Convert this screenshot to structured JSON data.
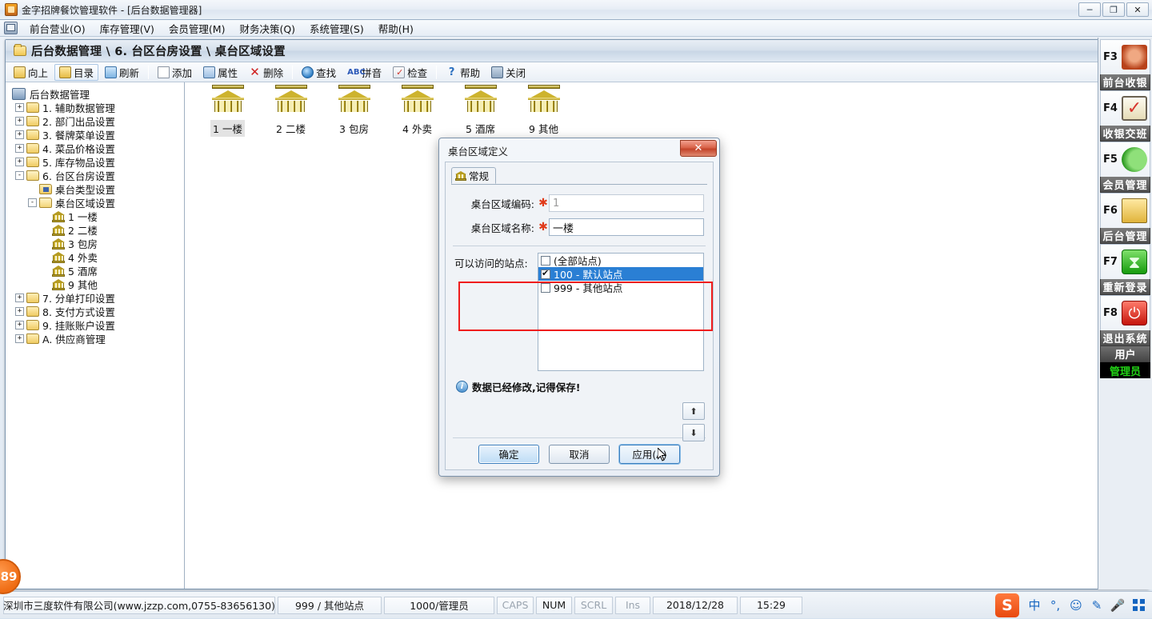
{
  "window": {
    "title": "金字招牌餐饮管理软件 - [后台数据管理器]",
    "app_icon": "app-logo-icon",
    "controls": {
      "minimize": "─",
      "restore": "❐",
      "close": "✕"
    }
  },
  "menubar": {
    "icon": "mdi-system-icon",
    "items": [
      {
        "label": "前台营业(O)"
      },
      {
        "label": "库存管理(V)"
      },
      {
        "label": "会员管理(M)"
      },
      {
        "label": "财务决策(Q)"
      },
      {
        "label": "系统管理(S)"
      },
      {
        "label": "帮助(H)"
      }
    ]
  },
  "mdi": {
    "controls": {
      "minimize": "─",
      "restore": "❐",
      "close": "✕"
    },
    "breadcrumb": {
      "icon": "folder-icon",
      "text": "后台数据管理 \\ 6. 台区台房设置 \\ 桌台区域设置"
    },
    "toolbar": [
      {
        "label": "向上",
        "icon": "up-folder-icon",
        "hot": false
      },
      {
        "label": "目录",
        "icon": "directory-icon",
        "hot": true
      },
      {
        "label": "刷新",
        "icon": "refresh-icon",
        "hot": false
      },
      {
        "sep": true
      },
      {
        "label": "添加",
        "icon": "add-icon",
        "hot": false
      },
      {
        "label": "属性",
        "icon": "properties-icon",
        "hot": false
      },
      {
        "label": "删除",
        "icon": "delete-icon",
        "hot": false
      },
      {
        "sep": true
      },
      {
        "label": "查找",
        "icon": "search-icon",
        "hot": false
      },
      {
        "label": "拼音",
        "icon": "pinyin-icon",
        "hot": false
      },
      {
        "label": "检查",
        "icon": "check-icon",
        "hot": false
      },
      {
        "sep": true
      },
      {
        "label": "帮助",
        "icon": "help-icon",
        "hot": false
      },
      {
        "label": "关闭",
        "icon": "close-door-icon",
        "hot": false
      }
    ]
  },
  "tree": {
    "root": {
      "label": "后台数据管理",
      "icon": "database-root-icon"
    },
    "nodes": [
      {
        "label": "1. 辅助数据管理",
        "expander": "+",
        "icon": "folder-icon",
        "indent": 1
      },
      {
        "label": "2. 部门出品设置",
        "expander": "+",
        "icon": "folder-icon",
        "indent": 1
      },
      {
        "label": "3. 餐牌菜单设置",
        "expander": "+",
        "icon": "folder-icon",
        "indent": 1
      },
      {
        "label": "4. 菜品价格设置",
        "expander": "+",
        "icon": "folder-icon",
        "indent": 1
      },
      {
        "label": "5. 库存物品设置",
        "expander": "+",
        "icon": "folder-icon",
        "indent": 1
      },
      {
        "label": "6. 台区台房设置",
        "expander": "-",
        "icon": "folder-open-icon",
        "indent": 1
      },
      {
        "label": "桌台类型设置",
        "expander": "",
        "icon": "folder-star-icon",
        "indent": 2
      },
      {
        "label": "桌台区域设置",
        "expander": "-",
        "icon": "folder-open-icon",
        "indent": 2
      },
      {
        "label": "1 一楼",
        "expander": "",
        "icon": "bank-icon",
        "indent": 3
      },
      {
        "label": "2 二楼",
        "expander": "",
        "icon": "bank-icon",
        "indent": 3
      },
      {
        "label": "3 包房",
        "expander": "",
        "icon": "bank-icon",
        "indent": 3
      },
      {
        "label": "4 外卖",
        "expander": "",
        "icon": "bank-icon",
        "indent": 3
      },
      {
        "label": "5 酒席",
        "expander": "",
        "icon": "bank-icon",
        "indent": 3
      },
      {
        "label": "9 其他",
        "expander": "",
        "icon": "bank-icon",
        "indent": 3
      },
      {
        "label": "7. 分单打印设置",
        "expander": "+",
        "icon": "folder-icon",
        "indent": 1
      },
      {
        "label": "8. 支付方式设置",
        "expander": "+",
        "icon": "folder-icon",
        "indent": 1
      },
      {
        "label": "9. 挂账账户设置",
        "expander": "+",
        "icon": "folder-icon",
        "indent": 1
      },
      {
        "label": "A. 供应商管理",
        "expander": "+",
        "icon": "folder-icon",
        "indent": 1
      }
    ]
  },
  "icon_list": {
    "items": [
      {
        "label": "1 一楼",
        "icon": "bank-icon",
        "selected": true
      },
      {
        "label": "2 二楼",
        "icon": "bank-icon",
        "selected": false
      },
      {
        "label": "3 包房",
        "icon": "bank-icon",
        "selected": false
      },
      {
        "label": "4 外卖",
        "icon": "bank-icon",
        "selected": false
      },
      {
        "label": "5 酒席",
        "icon": "bank-icon",
        "selected": false
      },
      {
        "label": "9 其他",
        "icon": "bank-icon",
        "selected": false
      }
    ]
  },
  "function_bar": {
    "cells": [
      {
        "key": "F3",
        "icon": "dining-table-icon",
        "label": "前台收银"
      },
      {
        "key": "F4",
        "icon": "clipboard-check-icon",
        "label": "收银交班"
      },
      {
        "key": "F5",
        "icon": "members-icon",
        "label": "会员管理"
      },
      {
        "key": "F6",
        "icon": "backoffice-tools-icon",
        "label": "后台管理"
      },
      {
        "key": "F7",
        "icon": "hourglass-icon",
        "label": "重新登录"
      },
      {
        "key": "F8",
        "icon": "power-icon",
        "label": "退出系统"
      }
    ],
    "user_caption": "用户",
    "user_name": "管理员"
  },
  "statusbar": {
    "company": "深圳市三度软件有限公司(www.jzzp.com,0755-83656130)",
    "station": "999 / 其他站点",
    "operator": "1000/管理员",
    "caps": "CAPS",
    "num": "NUM",
    "scrl": "SCRL",
    "ins": "Ins",
    "date": "2018/12/28",
    "time": "15:29"
  },
  "ime_tray": {
    "logo": "S",
    "items": [
      {
        "icon": "chinese-mode-icon",
        "glyph": "中"
      },
      {
        "icon": "punctuation-icon",
        "glyph": "°,"
      },
      {
        "icon": "emoji-icon",
        "glyph": "☺"
      },
      {
        "icon": "pen-icon",
        "glyph": "✎"
      },
      {
        "icon": "microphone-icon",
        "glyph": "🎤"
      },
      {
        "icon": "toolbox-grid-icon",
        "glyph": ""
      }
    ]
  },
  "badge": {
    "text": "89"
  },
  "dialog": {
    "title": "桌台区域定义",
    "close_label": "✕",
    "tab": {
      "label": "常规",
      "icon": "bank-icon"
    },
    "fields": [
      {
        "label": "桌台区域编码:",
        "required": "✱",
        "value": "1",
        "readonly": true,
        "placeholder": ""
      },
      {
        "label": "桌台区域名称:",
        "required": "✱",
        "value": "一楼",
        "readonly": false,
        "placeholder": ""
      }
    ],
    "stations": {
      "label": "可以访问的站点:",
      "rows": [
        {
          "text": "(全部站点)",
          "checked": false,
          "selected": false
        },
        {
          "text": "100 - 默认站点",
          "checked": true,
          "selected": true
        },
        {
          "text": "999 - 其他站点",
          "checked": false,
          "selected": false
        }
      ]
    },
    "note": {
      "icon": "info-icon",
      "text": "数据已经修改,记得保存!"
    },
    "order_buttons": [
      {
        "icon": "arrow-up-icon",
        "glyph": "⬆"
      },
      {
        "icon": "arrow-down-icon",
        "glyph": "⬇"
      }
    ],
    "buttons": [
      {
        "label": "确定",
        "state": "default"
      },
      {
        "label": "取消",
        "state": "normal"
      },
      {
        "label": "应用(A)",
        "state": "focus"
      }
    ]
  },
  "colors": {
    "accent": "#2a7fd4",
    "required": "#e03a1a",
    "highlight_box": "#ef1d1d",
    "fkey_label_bg": "#4f4f4f",
    "admin_green": "#22d416",
    "badge_orange": "#ef6c14"
  }
}
